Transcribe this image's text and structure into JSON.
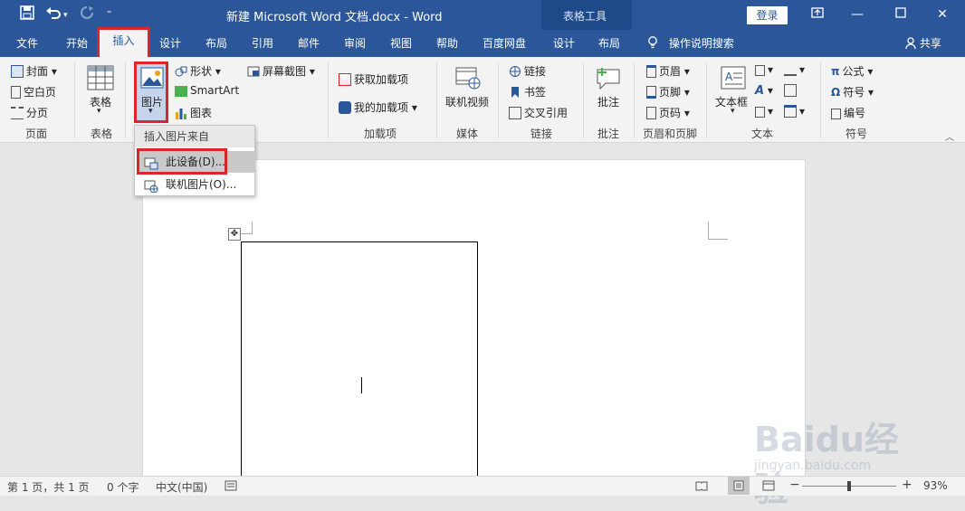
{
  "title_bar": {
    "doc_title": "新建 Microsoft Word 文档.docx - Word",
    "context_tab_group": "表格工具",
    "login_label": "登录",
    "qat_icons": [
      "save-icon",
      "undo-icon",
      "redo-icon",
      "customize-icon"
    ],
    "window_buttons": [
      "ribbon-display-icon",
      "minimize-icon",
      "maximize-icon",
      "close-icon"
    ]
  },
  "tabs": [
    "文件",
    "开始",
    "插入",
    "设计",
    "布局",
    "引用",
    "邮件",
    "审阅",
    "视图",
    "帮助",
    "百度网盘",
    "设计",
    "布局"
  ],
  "active_tab": "插入",
  "tell_me": "操作说明搜索",
  "share": "共享",
  "ribbon": {
    "pages": {
      "cover": "封面",
      "blank": "空白页",
      "break": "分页",
      "label": "页面"
    },
    "tables": {
      "table": "表格",
      "label": "表格"
    },
    "illustrations": {
      "picture": "图片",
      "shapes": "形状",
      "smartart": "SmartArt",
      "chart": "图表",
      "screenshot": "屏幕截图"
    },
    "addins": {
      "get": "获取加载项",
      "my": "我的加载项",
      "label": "加载项"
    },
    "media": {
      "video": "联机视频",
      "label": "媒体"
    },
    "links": {
      "link": "链接",
      "bookmark": "书签",
      "crossref": "交叉引用",
      "label": "链接"
    },
    "comments": {
      "comment": "批注",
      "label": "批注"
    },
    "header_footer": {
      "header": "页眉",
      "footer": "页脚",
      "page_number": "页码",
      "label": "页眉和页脚"
    },
    "text": {
      "textbox": "文本框",
      "label": "文本"
    },
    "symbols": {
      "equation": "公式",
      "symbol": "符号",
      "numbering": "编号",
      "label": "符号"
    }
  },
  "dropdown": {
    "header": "插入图片来自",
    "items": [
      "此设备(D)...",
      "联机图片(O)..."
    ]
  },
  "status": {
    "page": "第 1 页，共 1 页",
    "words": "0 个字",
    "language": "中文(中国)",
    "zoom": "93%"
  },
  "watermark": {
    "brand": "Baidu经验",
    "url": "jingyan.baidu.com"
  },
  "colors": {
    "accent": "#2b579a",
    "highlight": "#d9262c"
  }
}
